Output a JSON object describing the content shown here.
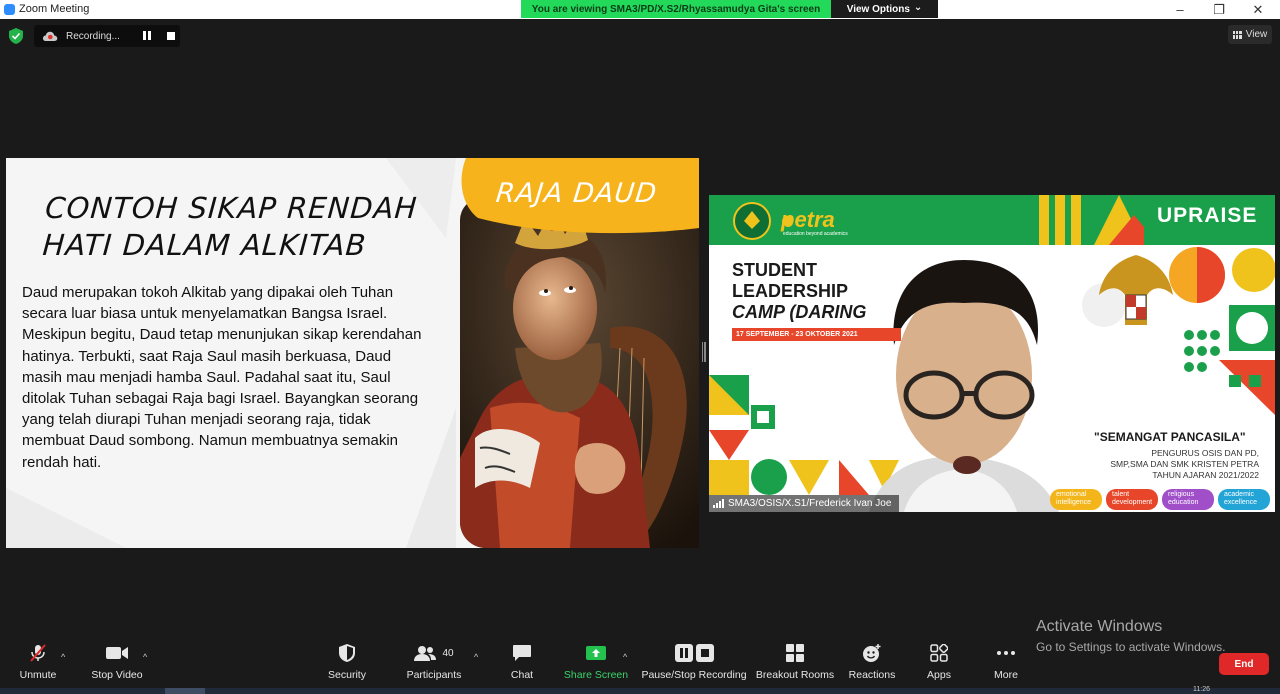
{
  "window": {
    "title": "Zoom Meeting",
    "minimize": "–",
    "maximize": "❐",
    "close": "✕"
  },
  "banner": {
    "viewing": "You are viewing SMA3/PD/X.S2/Rhyassamudya Gita's screen",
    "view_options": "View Options",
    "view_options_caret": "⌄"
  },
  "recording": {
    "label": "Recording..."
  },
  "view_button": {
    "label": "View"
  },
  "slide": {
    "heading": "CONTOH SIKAP RENDAH HATI DALAM ALKITAB",
    "tag": "RAJA DAUD",
    "body": "Daud merupakan tokoh Alkitab yang dipakai oleh Tuhan secara luar biasa untuk menyelamatkan Bangsa Israel. Meskipun begitu, Daud tetap menunjukan sikap kerendahan hatinya. Terbukti, saat Raja Saul masih berkuasa, Daud masih mau menjadi hamba Saul. Padahal saat itu, Saul ditolak Tuhan sebagai Raja bagi Israel. Bayangkan seorang yang telah diurapi Tuhan menjadi seorang raja, tidak membuat Daud sombong. Namun membuatnya semakin rendah hati.",
    "colors": {
      "accent": "#f6b31c",
      "background": "#f4f4f4"
    }
  },
  "participant": {
    "name": "SMA3/OSIS/X.S1/Frederick Ivan Joe",
    "background": {
      "logo_text": "petra",
      "logo_sub": "education beyond academics",
      "upraise": "UPRAISE",
      "camp_line1": "STUDENT",
      "camp_line2": "LEADERSHIP",
      "camp_line3": "CAMP (DARING",
      "dates": "17 SEPTEMBER - 23 OKTOBER 2021",
      "theme": "\"SEMANGAT PANCASILA\"",
      "org1": "PENGURUS OSIS DAN PD,",
      "org2": "SMP,SMA DAN SMK KRISTEN PETRA",
      "org3": "TAHUN AJARAN 2021/2022",
      "pills": [
        {
          "l1": "emotional",
          "l2": "intelligence",
          "color": "#f3b51a"
        },
        {
          "l1": "talent",
          "l2": "development",
          "color": "#e8462a"
        },
        {
          "l1": "religious",
          "l2": "education",
          "color": "#a04fc8"
        },
        {
          "l1": "academic",
          "l2": "excellence",
          "color": "#22a4d6"
        }
      ]
    }
  },
  "watermark": {
    "line1": "Activate Windows",
    "line2": "Go to Settings to activate Windows."
  },
  "toolbar": {
    "unmute": "Unmute",
    "stop_video": "Stop Video",
    "security": "Security",
    "participants": "Participants",
    "participant_count": "40",
    "chat": "Chat",
    "share_screen": "Share Screen",
    "pause_stop_recording": "Pause/Stop Recording",
    "breakout_rooms": "Breakout Rooms",
    "reactions": "Reactions",
    "apps": "Apps",
    "more": "More",
    "end": "End",
    "caret": "^"
  },
  "taskbar": {
    "clock": "11:26"
  }
}
